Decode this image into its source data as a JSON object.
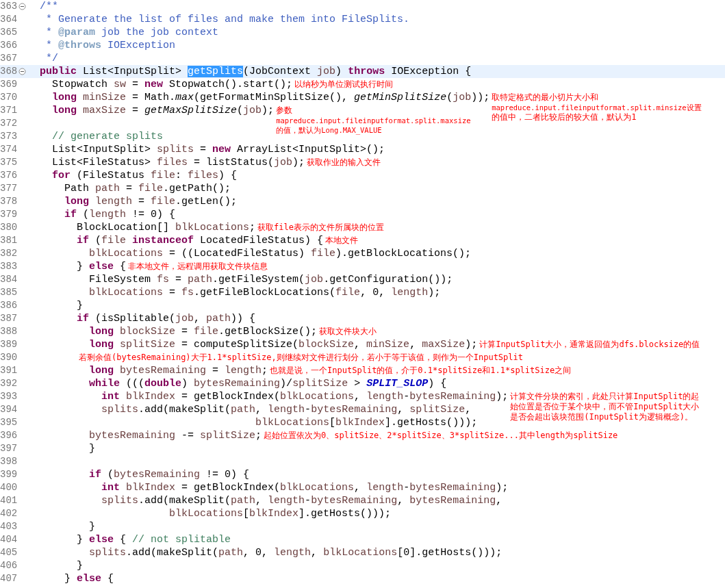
{
  "editor": {
    "lines": [
      {
        "number": "363",
        "fold": true,
        "current": false,
        "tokens": [
          {
            "kind": "jd",
            "text": "/**"
          }
        ]
      },
      {
        "number": "364",
        "fold": false,
        "current": false,
        "tokens": [
          {
            "kind": "jd",
            "text": " * Generate the list of files and make them into FileSplits."
          }
        ]
      },
      {
        "number": "365",
        "fold": false,
        "current": false,
        "tokens": [
          {
            "kind": "jd",
            "text": " * "
          },
          {
            "kind": "jt",
            "text": "@param"
          },
          {
            "kind": "jd",
            "text": " job the job context"
          }
        ]
      },
      {
        "number": "366",
        "fold": false,
        "current": false,
        "tokens": [
          {
            "kind": "jd",
            "text": " * "
          },
          {
            "kind": "jt",
            "text": "@throws"
          },
          {
            "kind": "jd",
            "text": " IOException"
          }
        ]
      },
      {
        "number": "367",
        "fold": false,
        "current": false,
        "tokens": [
          {
            "kind": "jd",
            "text": " */"
          }
        ]
      },
      {
        "number": "368",
        "fold": true,
        "current": true,
        "tokens": [
          {
            "kind": "kw",
            "text": "public "
          },
          {
            "kind": "p",
            "text": "List<InputSplit> "
          },
          {
            "kind": "sel",
            "text": "getSplits"
          },
          {
            "kind": "p",
            "text": "(JobContext "
          },
          {
            "kind": "v",
            "text": "job"
          },
          {
            "kind": "p",
            "text": ") "
          },
          {
            "kind": "kw",
            "text": "throws "
          },
          {
            "kind": "p",
            "text": "IOException {"
          }
        ]
      },
      {
        "number": "369",
        "fold": false,
        "current": false,
        "tokens": [
          {
            "kind": "p",
            "text": "  Stopwatch "
          },
          {
            "kind": "v",
            "text": "sw"
          },
          {
            "kind": "p",
            "text": " = "
          },
          {
            "kind": "kw",
            "text": "new "
          },
          {
            "kind": "p",
            "text": "Stopwatch().start();"
          }
        ],
        "note": [
          {
            "text": "以纳秒为单位测试执行时间",
            "small": false
          }
        ]
      },
      {
        "number": "370",
        "fold": false,
        "current": false,
        "tokens": [
          {
            "kind": "kw",
            "text": "  long "
          },
          {
            "kind": "v",
            "text": "minSize"
          },
          {
            "kind": "p",
            "text": " = Math."
          },
          {
            "kind": "it",
            "text": "max"
          },
          {
            "kind": "p",
            "text": "(getFormatMinSplitSize(), "
          },
          {
            "kind": "it",
            "text": "getMinSplitSize"
          },
          {
            "kind": "p",
            "text": "("
          },
          {
            "kind": "v",
            "text": "job"
          },
          {
            "kind": "p",
            "text": "));"
          }
        ],
        "note": [
          {
            "text": "取特定格式的最小切片大小和",
            "small": false
          },
          {
            "text": "mapreduce.input.fileinputformat.split.minsize设置",
            "small": true
          },
          {
            "text": "的值中，二者比较后的较大值，默认为1",
            "small": false
          }
        ]
      },
      {
        "number": "371",
        "fold": false,
        "current": false,
        "tokens": [
          {
            "kind": "kw",
            "text": "  long "
          },
          {
            "kind": "v",
            "text": "maxSize"
          },
          {
            "kind": "p",
            "text": " = "
          },
          {
            "kind": "it",
            "text": "getMaxSplitSize"
          },
          {
            "kind": "p",
            "text": "("
          },
          {
            "kind": "v",
            "text": "job"
          },
          {
            "kind": "p",
            "text": ");"
          }
        ],
        "note": [
          {
            "text": "参数",
            "small": false
          },
          {
            "text": "mapreduce.input.fileinputformat.split.maxsize",
            "small": true
          },
          {
            "text": "的值，默认为Long.MAX_VALUE",
            "small": true
          }
        ]
      },
      {
        "number": "372",
        "fold": false,
        "current": false
      },
      {
        "number": "373",
        "fold": false,
        "current": false,
        "tokens": [
          {
            "kind": "cm",
            "text": "  // generate splits"
          }
        ]
      },
      {
        "number": "374",
        "fold": false,
        "current": false,
        "tokens": [
          {
            "kind": "p",
            "text": "  List<InputSplit> "
          },
          {
            "kind": "v",
            "text": "splits"
          },
          {
            "kind": "p",
            "text": " = "
          },
          {
            "kind": "kw",
            "text": "new "
          },
          {
            "kind": "p",
            "text": "ArrayList<InputSplit>();"
          }
        ]
      },
      {
        "number": "375",
        "fold": false,
        "current": false,
        "tokens": [
          {
            "kind": "p",
            "text": "  List<FileStatus> "
          },
          {
            "kind": "v",
            "text": "files"
          },
          {
            "kind": "p",
            "text": " = listStatus("
          },
          {
            "kind": "v",
            "text": "job"
          },
          {
            "kind": "p",
            "text": ");"
          }
        ],
        "note": [
          {
            "text": "获取作业的输入文件",
            "small": false
          }
        ]
      },
      {
        "number": "376",
        "fold": false,
        "current": false,
        "tokens": [
          {
            "kind": "kw",
            "text": "  for "
          },
          {
            "kind": "p",
            "text": "(FileStatus "
          },
          {
            "kind": "v",
            "text": "file"
          },
          {
            "kind": "p",
            "text": ": "
          },
          {
            "kind": "v",
            "text": "files"
          },
          {
            "kind": "p",
            "text": ") {"
          }
        ]
      },
      {
        "number": "377",
        "fold": false,
        "current": false,
        "tokens": [
          {
            "kind": "p",
            "text": "    Path "
          },
          {
            "kind": "v",
            "text": "path"
          },
          {
            "kind": "p",
            "text": " = "
          },
          {
            "kind": "v",
            "text": "file"
          },
          {
            "kind": "p",
            "text": ".getPath();"
          }
        ]
      },
      {
        "number": "378",
        "fold": false,
        "current": false,
        "tokens": [
          {
            "kind": "kw",
            "text": "    long "
          },
          {
            "kind": "v",
            "text": "length"
          },
          {
            "kind": "p",
            "text": " = "
          },
          {
            "kind": "v",
            "text": "file"
          },
          {
            "kind": "p",
            "text": ".getLen();"
          }
        ]
      },
      {
        "number": "379",
        "fold": false,
        "current": false,
        "tokens": [
          {
            "kind": "kw",
            "text": "    if "
          },
          {
            "kind": "p",
            "text": "("
          },
          {
            "kind": "v",
            "text": "length"
          },
          {
            "kind": "p",
            "text": " != 0) {"
          }
        ]
      },
      {
        "number": "380",
        "fold": false,
        "current": false,
        "tokens": [
          {
            "kind": "p",
            "text": "      BlockLocation[] "
          },
          {
            "kind": "v",
            "text": "blkLocations"
          },
          {
            "kind": "p",
            "text": ";"
          }
        ],
        "note": [
          {
            "text": "获取file表示的文件所属块的位置",
            "small": false
          }
        ]
      },
      {
        "number": "381",
        "fold": false,
        "current": false,
        "tokens": [
          {
            "kind": "kw",
            "text": "      if "
          },
          {
            "kind": "p",
            "text": "("
          },
          {
            "kind": "v",
            "text": "file"
          },
          {
            "kind": "kw",
            "text": " instanceof "
          },
          {
            "kind": "p",
            "text": "LocatedFileStatus) {"
          }
        ],
        "note": [
          {
            "text": "本地文件",
            "small": false
          }
        ]
      },
      {
        "number": "382",
        "fold": false,
        "current": false,
        "tokens": [
          {
            "kind": "v",
            "text": "        blkLocations"
          },
          {
            "kind": "p",
            "text": " = ((LocatedFileStatus) "
          },
          {
            "kind": "v",
            "text": "file"
          },
          {
            "kind": "p",
            "text": ").getBlockLocations();"
          }
        ]
      },
      {
        "number": "383",
        "fold": false,
        "current": false,
        "tokens": [
          {
            "kind": "p",
            "text": "      } "
          },
          {
            "kind": "kw",
            "text": "else "
          },
          {
            "kind": "p",
            "text": "{"
          }
        ],
        "note": [
          {
            "text": "非本地文件，远程调用获取文件块信息",
            "small": false
          }
        ]
      },
      {
        "number": "384",
        "fold": false,
        "current": false,
        "tokens": [
          {
            "kind": "p",
            "text": "        FileSystem "
          },
          {
            "kind": "v",
            "text": "fs"
          },
          {
            "kind": "p",
            "text": " = "
          },
          {
            "kind": "v",
            "text": "path"
          },
          {
            "kind": "p",
            "text": ".getFileSystem("
          },
          {
            "kind": "v",
            "text": "job"
          },
          {
            "kind": "p",
            "text": ".getConfiguration());"
          }
        ]
      },
      {
        "number": "385",
        "fold": false,
        "current": false,
        "tokens": [
          {
            "kind": "v",
            "text": "        blkLocations"
          },
          {
            "kind": "p",
            "text": " = "
          },
          {
            "kind": "v",
            "text": "fs"
          },
          {
            "kind": "p",
            "text": ".getFileBlockLocations("
          },
          {
            "kind": "v",
            "text": "file"
          },
          {
            "kind": "p",
            "text": ", 0, "
          },
          {
            "kind": "v",
            "text": "length"
          },
          {
            "kind": "p",
            "text": ");"
          }
        ]
      },
      {
        "number": "386",
        "fold": false,
        "current": false,
        "tokens": [
          {
            "kind": "p",
            "text": "      }"
          }
        ]
      },
      {
        "number": "387",
        "fold": false,
        "current": false,
        "tokens": [
          {
            "kind": "kw",
            "text": "      if "
          },
          {
            "kind": "p",
            "text": "(isSplitable("
          },
          {
            "kind": "v",
            "text": "job"
          },
          {
            "kind": "p",
            "text": ", "
          },
          {
            "kind": "v",
            "text": "path"
          },
          {
            "kind": "p",
            "text": ")) {"
          }
        ]
      },
      {
        "number": "388",
        "fold": false,
        "current": false,
        "tokens": [
          {
            "kind": "kw",
            "text": "        long "
          },
          {
            "kind": "v",
            "text": "blockSize"
          },
          {
            "kind": "p",
            "text": " = "
          },
          {
            "kind": "v",
            "text": "file"
          },
          {
            "kind": "p",
            "text": ".getBlockSize();"
          }
        ],
        "note": [
          {
            "text": "获取文件块大小",
            "small": false
          }
        ]
      },
      {
        "number": "389",
        "fold": false,
        "current": false,
        "tokens": [
          {
            "kind": "kw",
            "text": "        long "
          },
          {
            "kind": "v",
            "text": "splitSize"
          },
          {
            "kind": "p",
            "text": " = computeSplitSize("
          },
          {
            "kind": "v",
            "text": "blockSize"
          },
          {
            "kind": "p",
            "text": ", "
          },
          {
            "kind": "v",
            "text": "minSize"
          },
          {
            "kind": "p",
            "text": ", "
          },
          {
            "kind": "v",
            "text": "maxSize"
          },
          {
            "kind": "p",
            "text": ");"
          }
        ],
        "note": [
          {
            "text": "计算InputSplit大小，通常返回值为dfs.blocksize的值",
            "small": false
          }
        ]
      },
      {
        "number": "390",
        "fold": false,
        "current": false,
        "note": [
          {
            "text": "若剩余值(bytesRemaining)大于1.1*splitSize,则继续对文件进行划分，若小于等于该值，则作为一个InputSplit",
            "small": false
          }
        ]
      },
      {
        "number": "391",
        "fold": false,
        "current": false,
        "tokens": [
          {
            "kind": "kw",
            "text": "        long "
          },
          {
            "kind": "v",
            "text": "bytesRemaining"
          },
          {
            "kind": "p",
            "text": " = "
          },
          {
            "kind": "v",
            "text": "length"
          },
          {
            "kind": "p",
            "text": ";"
          }
        ],
        "note": [
          {
            "text": "也就是说，一个InputSplit的值，介于0.1*splitSize和1.1*splitSize之间",
            "small": false
          }
        ]
      },
      {
        "number": "392",
        "fold": false,
        "current": false,
        "tokens": [
          {
            "kind": "kw",
            "text": "        while "
          },
          {
            "kind": "p",
            "text": "((("
          },
          {
            "kind": "kw",
            "text": "double"
          },
          {
            "kind": "p",
            "text": ") "
          },
          {
            "kind": "v",
            "text": "bytesRemaining"
          },
          {
            "kind": "p",
            "text": ")/"
          },
          {
            "kind": "v",
            "text": "splitSize"
          },
          {
            "kind": "p",
            "text": " > "
          },
          {
            "kind": "c",
            "text": "SPLIT_SLOP"
          },
          {
            "kind": "p",
            "text": ") {"
          }
        ]
      },
      {
        "number": "393",
        "fold": false,
        "current": false,
        "tokens": [
          {
            "kind": "kw",
            "text": "          int "
          },
          {
            "kind": "v",
            "text": "blkIndex"
          },
          {
            "kind": "p",
            "text": " = getBlockIndex("
          },
          {
            "kind": "v",
            "text": "blkLocations"
          },
          {
            "kind": "p",
            "text": ", "
          },
          {
            "kind": "v",
            "text": "length"
          },
          {
            "kind": "p",
            "text": "-"
          },
          {
            "kind": "v",
            "text": "bytesRemaining"
          },
          {
            "kind": "p",
            "text": ");"
          }
        ],
        "note": [
          {
            "text": "计算文件分块的索引，此处只计算InputSplit的起",
            "small": false
          },
          {
            "text": "始位置是否位于某个块中，而不管InputSplit大小",
            "small": false
          },
          {
            "text": "是否会超出该块范围(InputSplit为逻辑概念)。",
            "small": false
          }
        ]
      },
      {
        "number": "394",
        "fold": false,
        "current": false,
        "tokens": [
          {
            "kind": "v",
            "text": "          splits"
          },
          {
            "kind": "p",
            "text": ".add(makeSplit("
          },
          {
            "kind": "v",
            "text": "path"
          },
          {
            "kind": "p",
            "text": ", "
          },
          {
            "kind": "v",
            "text": "length"
          },
          {
            "kind": "p",
            "text": "-"
          },
          {
            "kind": "v",
            "text": "bytesRemaining"
          },
          {
            "kind": "p",
            "text": ", "
          },
          {
            "kind": "v",
            "text": "splitSize"
          },
          {
            "kind": "p",
            "text": ","
          }
        ]
      },
      {
        "number": "395",
        "fold": false,
        "current": false,
        "tokens": [
          {
            "kind": "v",
            "text": "                                   blkLocations"
          },
          {
            "kind": "p",
            "text": "["
          },
          {
            "kind": "v",
            "text": "blkIndex"
          },
          {
            "kind": "p",
            "text": "].getHosts()));"
          }
        ]
      },
      {
        "number": "396",
        "fold": false,
        "current": false,
        "tokens": [
          {
            "kind": "v",
            "text": "        bytesRemaining"
          },
          {
            "kind": "p",
            "text": " -= "
          },
          {
            "kind": "v",
            "text": "splitSize"
          },
          {
            "kind": "p",
            "text": ";"
          }
        ],
        "note": [
          {
            "text": "起始位置依次为0、splitSize、2*splitSize、3*splitSize...其中length为splitSize",
            "small": false
          }
        ]
      },
      {
        "number": "397",
        "fold": false,
        "current": false,
        "tokens": [
          {
            "kind": "p",
            "text": "        }"
          }
        ]
      },
      {
        "number": "398",
        "fold": false,
        "current": false
      },
      {
        "number": "399",
        "fold": false,
        "current": false,
        "tokens": [
          {
            "kind": "kw",
            "text": "        if "
          },
          {
            "kind": "p",
            "text": "("
          },
          {
            "kind": "v",
            "text": "bytesRemaining"
          },
          {
            "kind": "p",
            "text": " != 0) {"
          }
        ]
      },
      {
        "number": "400",
        "fold": false,
        "current": false,
        "tokens": [
          {
            "kind": "kw",
            "text": "          int "
          },
          {
            "kind": "v",
            "text": "blkIndex"
          },
          {
            "kind": "p",
            "text": " = getBlockIndex("
          },
          {
            "kind": "v",
            "text": "blkLocations"
          },
          {
            "kind": "p",
            "text": ", "
          },
          {
            "kind": "v",
            "text": "length"
          },
          {
            "kind": "p",
            "text": "-"
          },
          {
            "kind": "v",
            "text": "bytesRemaining"
          },
          {
            "kind": "p",
            "text": ");"
          }
        ]
      },
      {
        "number": "401",
        "fold": false,
        "current": false,
        "tokens": [
          {
            "kind": "v",
            "text": "          splits"
          },
          {
            "kind": "p",
            "text": ".add(makeSplit("
          },
          {
            "kind": "v",
            "text": "path"
          },
          {
            "kind": "p",
            "text": ", "
          },
          {
            "kind": "v",
            "text": "length"
          },
          {
            "kind": "p",
            "text": "-"
          },
          {
            "kind": "v",
            "text": "bytesRemaining"
          },
          {
            "kind": "p",
            "text": ", "
          },
          {
            "kind": "v",
            "text": "bytesRemaining"
          },
          {
            "kind": "p",
            "text": ","
          }
        ]
      },
      {
        "number": "402",
        "fold": false,
        "current": false,
        "tokens": [
          {
            "kind": "v",
            "text": "                     blkLocations"
          },
          {
            "kind": "p",
            "text": "["
          },
          {
            "kind": "v",
            "text": "blkIndex"
          },
          {
            "kind": "p",
            "text": "].getHosts()));"
          }
        ]
      },
      {
        "number": "403",
        "fold": false,
        "current": false,
        "tokens": [
          {
            "kind": "p",
            "text": "        }"
          }
        ]
      },
      {
        "number": "404",
        "fold": false,
        "current": false,
        "tokens": [
          {
            "kind": "p",
            "text": "      } "
          },
          {
            "kind": "kw",
            "text": "else "
          },
          {
            "kind": "p",
            "text": "{ "
          },
          {
            "kind": "cm",
            "text": "// not splitable"
          }
        ]
      },
      {
        "number": "405",
        "fold": false,
        "current": false,
        "tokens": [
          {
            "kind": "v",
            "text": "        splits"
          },
          {
            "kind": "p",
            "text": ".add(makeSplit("
          },
          {
            "kind": "v",
            "text": "path"
          },
          {
            "kind": "p",
            "text": ", 0, "
          },
          {
            "kind": "v",
            "text": "length"
          },
          {
            "kind": "p",
            "text": ", "
          },
          {
            "kind": "v",
            "text": "blkLocations"
          },
          {
            "kind": "p",
            "text": "[0].getHosts()));"
          }
        ]
      },
      {
        "number": "406",
        "fold": false,
        "current": false,
        "tokens": [
          {
            "kind": "p",
            "text": "      }"
          }
        ]
      },
      {
        "number": "407",
        "fold": false,
        "current": false,
        "tokens": [
          {
            "kind": "p",
            "text": "    } "
          },
          {
            "kind": "kw",
            "text": "else "
          },
          {
            "kind": "p",
            "text": "{"
          }
        ]
      }
    ]
  }
}
